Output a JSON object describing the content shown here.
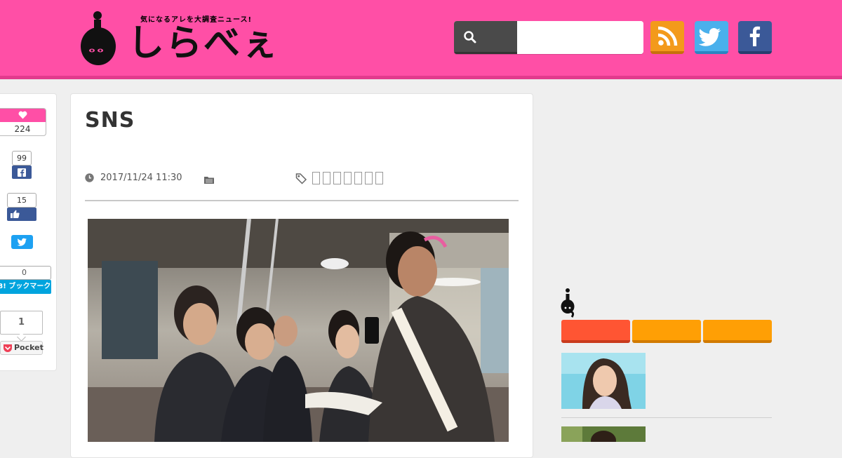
{
  "header": {
    "tagline": "気になるアレを大調査ニュース!",
    "logo_text": "しらべぇ",
    "search": {
      "placeholder": "",
      "value": ""
    },
    "social": [
      {
        "name": "rss-icon",
        "color": "#f39a1b"
      },
      {
        "name": "twitter-icon",
        "color": "#4ab0ec"
      },
      {
        "name": "facebook-icon",
        "color": "#3b5998"
      }
    ]
  },
  "share": {
    "likes": "224",
    "facebook_count": "99",
    "fb_like_count": "15",
    "hatena_count": "0",
    "hatena_label": "B! ブックマーク",
    "pocket_count": "1",
    "pocket_label": "Pocket"
  },
  "article": {
    "title": "SNS",
    "datetime": "2017/11/24 11:30",
    "tags_glyphs": [
      "□",
      "□",
      "□",
      "□",
      "□",
      "□",
      "□"
    ]
  },
  "sidebar": {
    "tabs": [
      {
        "label": "",
        "color": "#ff5533"
      },
      {
        "label": "",
        "color": "#ff9f05"
      },
      {
        "label": "",
        "color": "#ff9f05"
      }
    ]
  },
  "colors": {
    "header_pink": "#ff4fa6",
    "page_bg": "#efefef"
  }
}
